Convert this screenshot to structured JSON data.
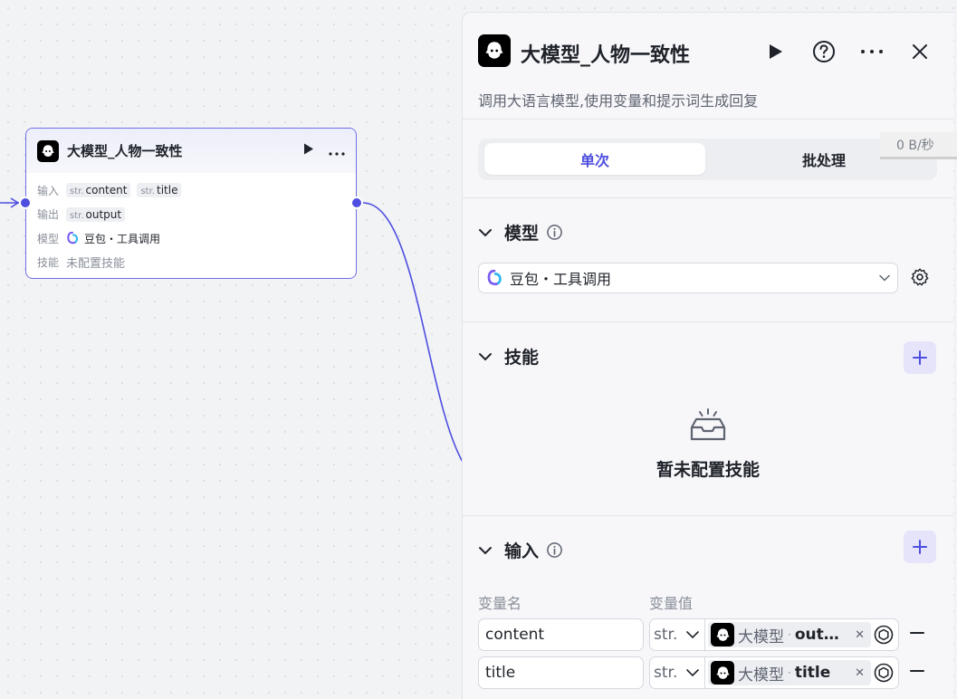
{
  "node": {
    "title": "大模型_人物一致性",
    "inputs_label": "输入",
    "outputs_label": "输出",
    "model_label": "模型",
    "skills_label": "技能",
    "inputs": [
      {
        "type": "str.",
        "name": "content"
      },
      {
        "type": "str.",
        "name": "title"
      }
    ],
    "outputs": [
      {
        "type": "str.",
        "name": "output"
      }
    ],
    "model_value": "豆包・工具调用",
    "skills_value": "未配置技能"
  },
  "panel": {
    "title": "大模型_人物一致性",
    "description": "调用大语言模型,使用变量和提示词生成回复",
    "tabs": [
      {
        "label": "单次",
        "active": true
      },
      {
        "label": "批处理",
        "active": false
      }
    ],
    "speed": "0 B/秒",
    "model_section": {
      "title": "模型",
      "selected": "豆包・工具调用"
    },
    "skills_section": {
      "title": "技能",
      "empty_text": "暂未配置技能"
    },
    "input_section": {
      "title": "输入",
      "col_name": "变量名",
      "col_value": "变量值",
      "rows": [
        {
          "name": "content",
          "type": "str.",
          "ref_node": "大模型",
          "ref_var": "out…"
        },
        {
          "name": "title",
          "type": "str.",
          "ref_node": "大模型",
          "ref_var": "title"
        }
      ]
    }
  },
  "colors": {
    "accent": "#4e4ee0",
    "accent_soft": "#e5e4fb",
    "text": "#1f2329",
    "muted": "#8a8f99",
    "border": "#d6d8de"
  },
  "icons": [
    "avatar-logo-icon",
    "play-icon",
    "help-icon",
    "more-icon",
    "close-icon",
    "chevron-down-icon",
    "info-icon",
    "plus-icon",
    "gear-icon",
    "inbox-empty-icon",
    "variable-pick-icon",
    "minus-icon",
    "doubao-logo-icon"
  ]
}
